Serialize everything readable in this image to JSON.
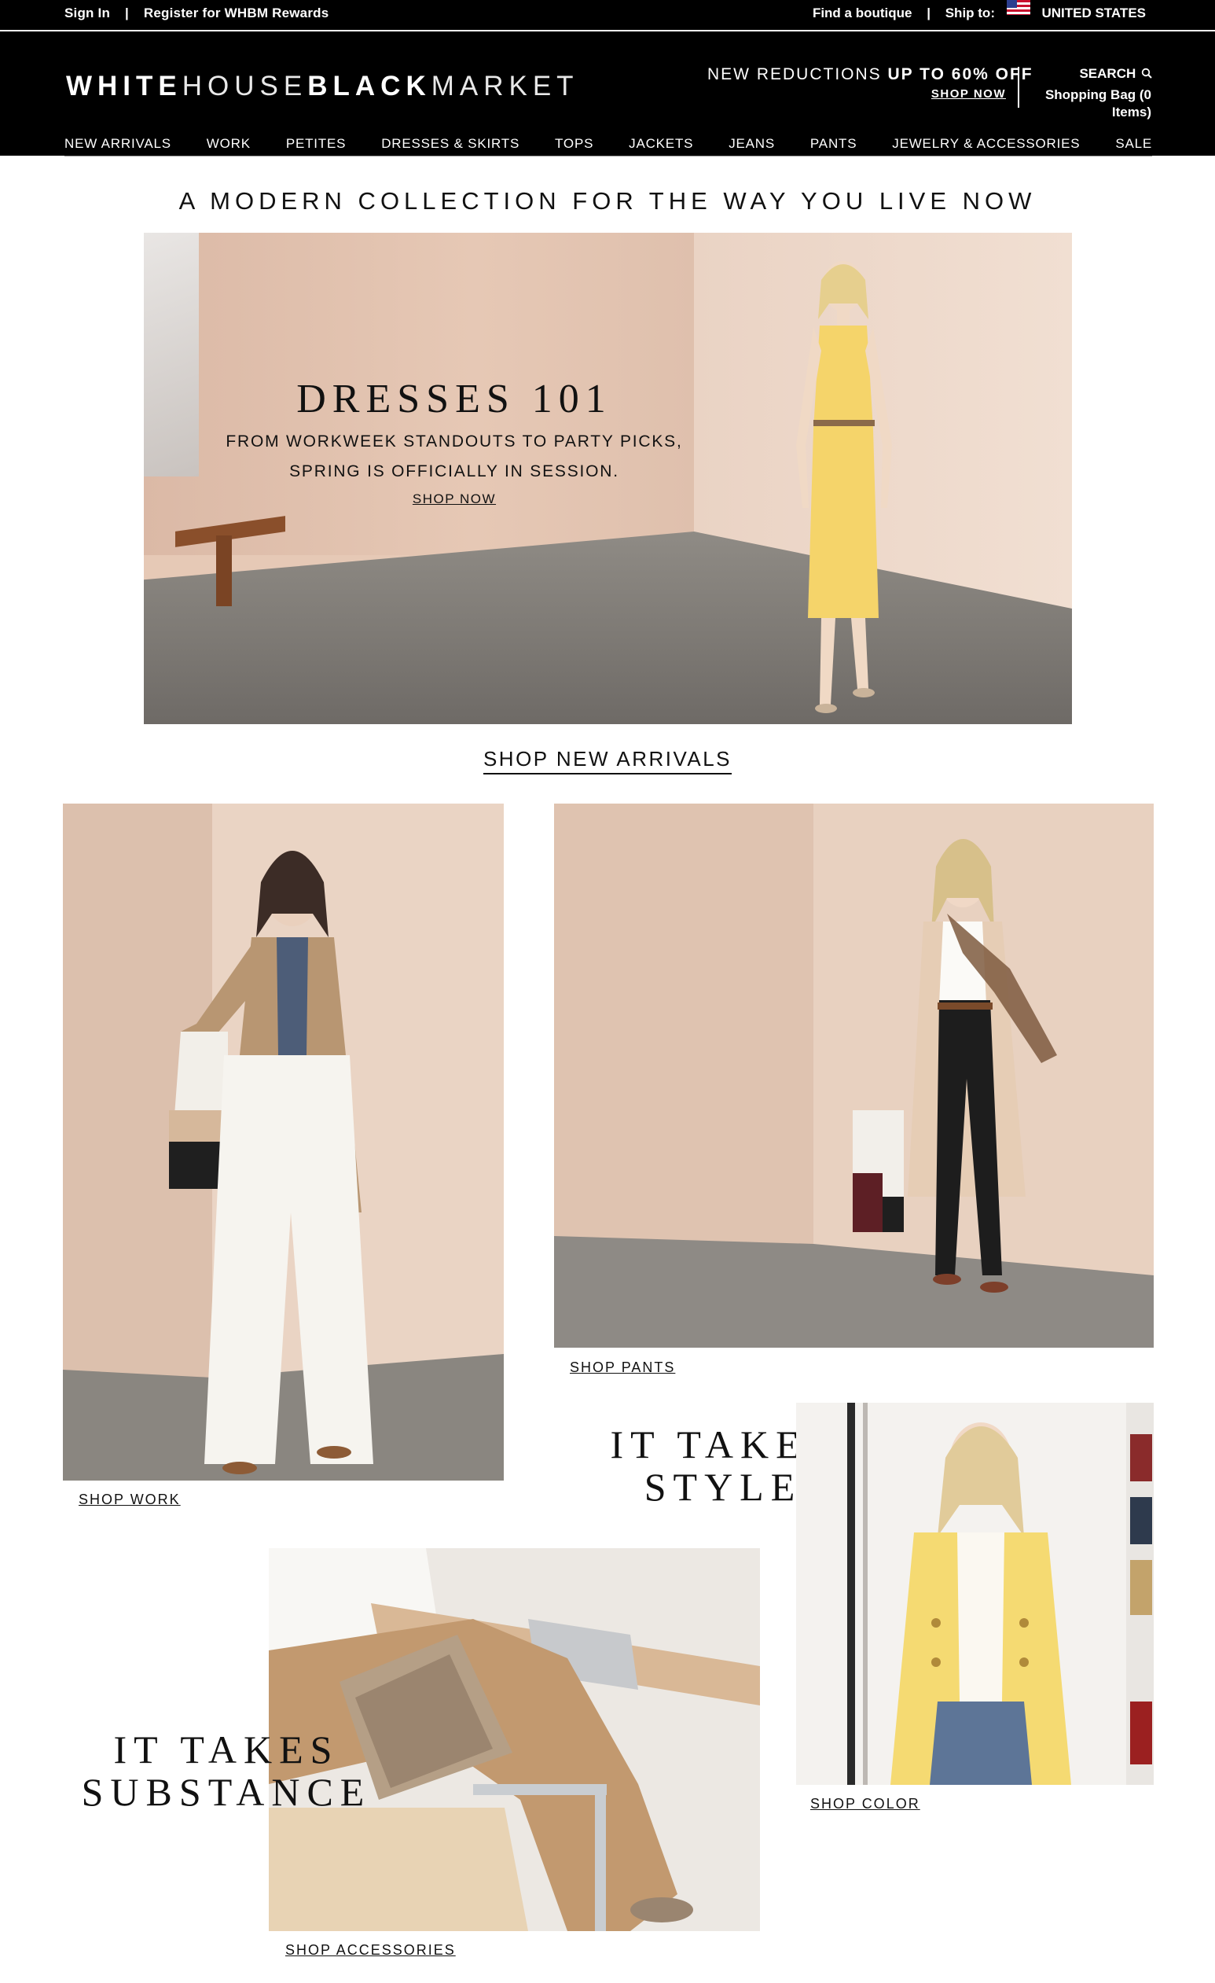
{
  "utility_bar": {
    "sign_in": "Sign In",
    "separator": "|",
    "register": "Register for WHBM Rewards",
    "find_boutique": "Find a boutique",
    "ship_to_label": "Ship to:",
    "country": "UNITED STATES",
    "flag_icon": "us-flag-icon"
  },
  "header": {
    "logo_parts": [
      "WHITE",
      "HOUSE",
      "BLACK",
      "MARKET"
    ],
    "promo_prefix": "NEW REDUCTIONS",
    "promo_highlight": "UP TO 60% OFF",
    "promo_link": "SHOP NOW",
    "search_label": "SEARCH",
    "search_icon": "magnifier-icon",
    "bag_label": "Shopping Bag (0 Items)"
  },
  "nav": {
    "items": [
      "NEW ARRIVALS",
      "WORK",
      "PETITES",
      "DRESSES & SKIRTS",
      "TOPS",
      "JACKETS",
      "JEANS",
      "PANTS",
      "JEWELRY & ACCESSORIES",
      "SALE"
    ]
  },
  "main": {
    "tagline": "A MODERN COLLECTION FOR THE WAY YOU LIVE NOW",
    "hero": {
      "title": "DRESSES 101",
      "subtitle_line1": "FROM WORKWEEK STANDOUTS TO PARTY PICKS,",
      "subtitle_line2": "SPRING IS OFFICIALLY IN SESSION.",
      "cta": "SHOP NOW"
    },
    "shop_new_arrivals": "SHOP NEW ARRIVALS",
    "tiles": {
      "work_caption": "SHOP WORK",
      "pants_caption": "SHOP PANTS",
      "color_caption": "SHOP COLOR",
      "accessories_caption": "SHOP ACCESSORIES"
    },
    "style_heading": [
      "IT TAKES",
      "STYLE"
    ],
    "substance_heading": [
      "IT TAKES",
      "SUBSTANCE"
    ]
  },
  "colors": {
    "black": "#000000",
    "blush_background": "#e8d2c2",
    "text": "#111111"
  }
}
